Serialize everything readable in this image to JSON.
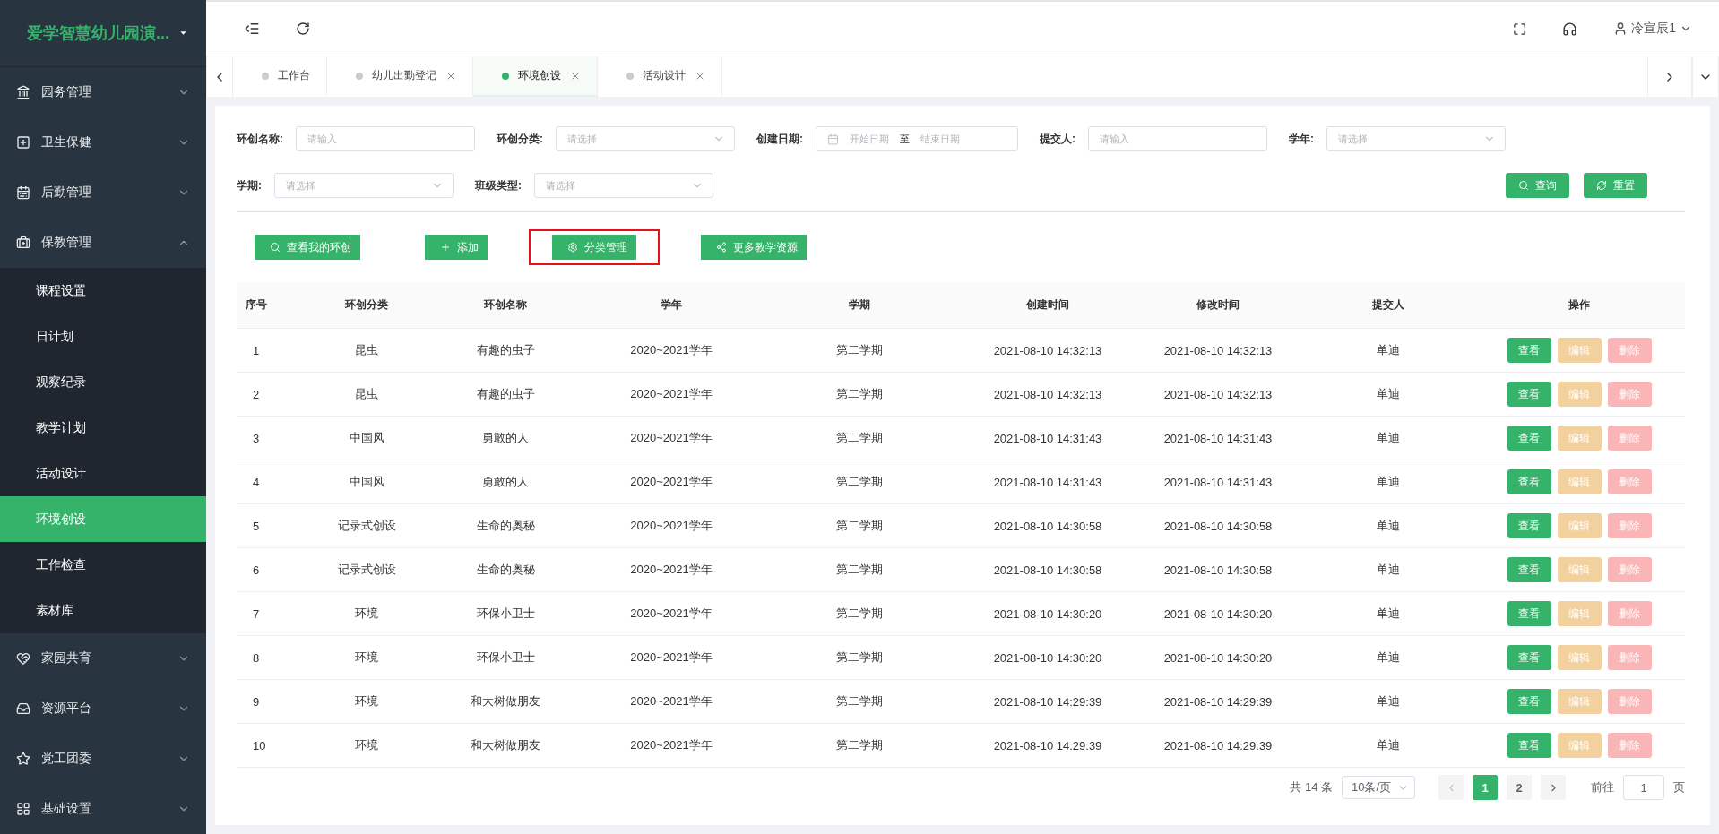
{
  "sidebar": {
    "logo": "爱学智慧幼儿园演...",
    "items": [
      {
        "label": "园务管理",
        "expanded": false
      },
      {
        "label": "卫生保健",
        "expanded": false
      },
      {
        "label": "后勤管理",
        "expanded": false
      },
      {
        "label": "保教管理",
        "expanded": true,
        "children": [
          {
            "label": "课程设置",
            "selected": false
          },
          {
            "label": "日计划",
            "selected": false
          },
          {
            "label": "观察纪录",
            "selected": false
          },
          {
            "label": "教学计划",
            "selected": false
          },
          {
            "label": "活动设计",
            "selected": false
          },
          {
            "label": "环境创设",
            "selected": true
          },
          {
            "label": "工作检查",
            "selected": false
          },
          {
            "label": "素材库",
            "selected": false
          }
        ]
      },
      {
        "label": "家园共育",
        "expanded": false
      },
      {
        "label": "资源平台",
        "expanded": false
      },
      {
        "label": "党工团委",
        "expanded": false
      },
      {
        "label": "基础设置",
        "expanded": false
      }
    ]
  },
  "header": {
    "user": "冷宣辰1"
  },
  "tabs": [
    {
      "label": "工作台",
      "selected": false,
      "closable": false
    },
    {
      "label": "幼儿出勤登记",
      "selected": false,
      "closable": true
    },
    {
      "label": "环境创设",
      "selected": true,
      "closable": true
    },
    {
      "label": "活动设计",
      "selected": false,
      "closable": true
    }
  ],
  "filters": [
    {
      "kind": "input",
      "label": "环创名称:",
      "placeholder": "请输入"
    },
    {
      "kind": "select",
      "label": "环创分类:",
      "placeholder": "请选择"
    },
    {
      "kind": "daterange",
      "label": "创建日期:",
      "start_placeholder": "开始日期",
      "separator": "至",
      "end_placeholder": "结束日期"
    },
    {
      "kind": "input",
      "label": "提交人:",
      "placeholder": "请输入"
    },
    {
      "kind": "select",
      "label": "学年:",
      "placeholder": "请选择"
    },
    {
      "kind": "select",
      "label": "学期:",
      "placeholder": "请选择"
    },
    {
      "kind": "select",
      "label": "班级类型:",
      "placeholder": "请选择"
    }
  ],
  "filter_buttons": [
    {
      "label": "查询",
      "kind": "search"
    },
    {
      "label": "重置",
      "kind": "reset"
    }
  ],
  "toolbar": [
    {
      "label": "查看我的环创",
      "kind": "search",
      "highlighted": false
    },
    {
      "label": "添加",
      "kind": "add",
      "highlighted": false
    },
    {
      "label": "分类管理",
      "kind": "settings",
      "highlighted": true
    },
    {
      "label": "更多教学资源",
      "kind": "share",
      "highlighted": false
    }
  ],
  "table": {
    "columns": [
      "序号",
      "环创分类",
      "环创名称",
      "学年",
      "学期",
      "创建时间",
      "修改时间",
      "提交人",
      "操作"
    ],
    "rows": [
      {
        "cells": [
          "1",
          "昆虫",
          "有趣的虫子",
          "2020~2021学年",
          "第二学期",
          "2021-08-10 14:32:13",
          "2021-08-10 14:32:13",
          "单迪"
        ],
        "actions": [
          {
            "label": "查看",
            "kind": "view",
            "disabled": false
          },
          {
            "label": "编辑",
            "kind": "edit",
            "disabled": true
          },
          {
            "label": "删除",
            "kind": "delete",
            "disabled": true
          }
        ]
      },
      {
        "cells": [
          "2",
          "昆虫",
          "有趣的虫子",
          "2020~2021学年",
          "第二学期",
          "2021-08-10 14:32:13",
          "2021-08-10 14:32:13",
          "单迪"
        ],
        "actions": [
          {
            "label": "查看",
            "kind": "view",
            "disabled": false
          },
          {
            "label": "编辑",
            "kind": "edit",
            "disabled": true
          },
          {
            "label": "删除",
            "kind": "delete",
            "disabled": true
          }
        ]
      },
      {
        "cells": [
          "3",
          "中国风",
          "勇敢的人",
          "2020~2021学年",
          "第二学期",
          "2021-08-10 14:31:43",
          "2021-08-10 14:31:43",
          "单迪"
        ],
        "actions": [
          {
            "label": "查看",
            "kind": "view",
            "disabled": false
          },
          {
            "label": "编辑",
            "kind": "edit",
            "disabled": true
          },
          {
            "label": "删除",
            "kind": "delete",
            "disabled": true
          }
        ]
      },
      {
        "cells": [
          "4",
          "中国风",
          "勇敢的人",
          "2020~2021学年",
          "第二学期",
          "2021-08-10 14:31:43",
          "2021-08-10 14:31:43",
          "单迪"
        ],
        "actions": [
          {
            "label": "查看",
            "kind": "view",
            "disabled": false
          },
          {
            "label": "编辑",
            "kind": "edit",
            "disabled": true
          },
          {
            "label": "删除",
            "kind": "delete",
            "disabled": true
          }
        ]
      },
      {
        "cells": [
          "5",
          "记录式创设",
          "生命的奥秘",
          "2020~2021学年",
          "第二学期",
          "2021-08-10 14:30:58",
          "2021-08-10 14:30:58",
          "单迪"
        ],
        "actions": [
          {
            "label": "查看",
            "kind": "view",
            "disabled": false
          },
          {
            "label": "编辑",
            "kind": "edit",
            "disabled": true
          },
          {
            "label": "删除",
            "kind": "delete",
            "disabled": true
          }
        ]
      },
      {
        "cells": [
          "6",
          "记录式创设",
          "生命的奥秘",
          "2020~2021学年",
          "第二学期",
          "2021-08-10 14:30:58",
          "2021-08-10 14:30:58",
          "单迪"
        ],
        "actions": [
          {
            "label": "查看",
            "kind": "view",
            "disabled": false
          },
          {
            "label": "编辑",
            "kind": "edit",
            "disabled": true
          },
          {
            "label": "删除",
            "kind": "delete",
            "disabled": true
          }
        ]
      },
      {
        "cells": [
          "7",
          "环境",
          "环保小卫士",
          "2020~2021学年",
          "第二学期",
          "2021-08-10 14:30:20",
          "2021-08-10 14:30:20",
          "单迪"
        ],
        "actions": [
          {
            "label": "查看",
            "kind": "view",
            "disabled": false
          },
          {
            "label": "编辑",
            "kind": "edit",
            "disabled": true
          },
          {
            "label": "删除",
            "kind": "delete",
            "disabled": true
          }
        ]
      },
      {
        "cells": [
          "8",
          "环境",
          "环保小卫士",
          "2020~2021学年",
          "第二学期",
          "2021-08-10 14:30:20",
          "2021-08-10 14:30:20",
          "单迪"
        ],
        "actions": [
          {
            "label": "查看",
            "kind": "view",
            "disabled": false
          },
          {
            "label": "编辑",
            "kind": "edit",
            "disabled": true
          },
          {
            "label": "删除",
            "kind": "delete",
            "disabled": true
          }
        ]
      },
      {
        "cells": [
          "9",
          "环境",
          "和大树做朋友",
          "2020~2021学年",
          "第二学期",
          "2021-08-10 14:29:39",
          "2021-08-10 14:29:39",
          "单迪"
        ],
        "actions": [
          {
            "label": "查看",
            "kind": "view",
            "disabled": false
          },
          {
            "label": "编辑",
            "kind": "edit",
            "disabled": true
          },
          {
            "label": "删除",
            "kind": "delete",
            "disabled": true
          }
        ]
      },
      {
        "cells": [
          "10",
          "环境",
          "和大树做朋友",
          "2020~2021学年",
          "第二学期",
          "2021-08-10 14:29:39",
          "2021-08-10 14:29:39",
          "单迪"
        ],
        "actions": [
          {
            "label": "查看",
            "kind": "view",
            "disabled": false
          },
          {
            "label": "编辑",
            "kind": "edit",
            "disabled": true
          },
          {
            "label": "删除",
            "kind": "delete",
            "disabled": true
          }
        ]
      }
    ]
  },
  "pagination": {
    "total": "共 14 条",
    "page_size": "10条/页",
    "pages": [
      {
        "label": "1",
        "selected": true
      },
      {
        "label": "2",
        "selected": false
      }
    ],
    "goto_label": "前往",
    "goto_value": "1",
    "goto_suffix": "页"
  }
}
